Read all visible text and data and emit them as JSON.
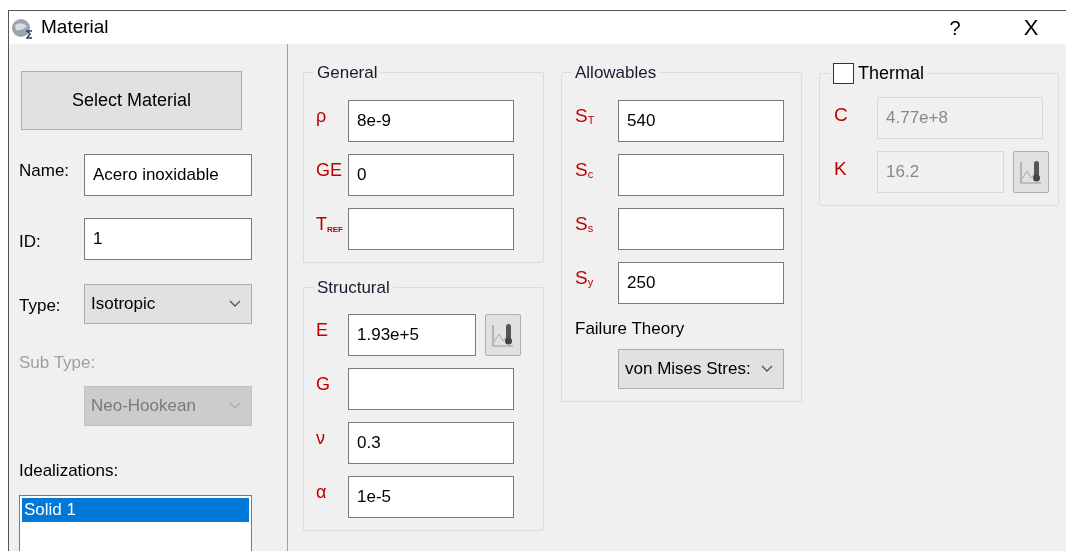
{
  "window": {
    "title": "Material",
    "help": "?",
    "close": "X"
  },
  "left": {
    "select_button": "Select Material",
    "name": {
      "label": "Name:",
      "value": "Acero inoxidable"
    },
    "id": {
      "label": "ID:",
      "value": "1"
    },
    "type": {
      "label": "Type:",
      "value": "Isotropic",
      "disabled": false
    },
    "sub_type": {
      "label": "Sub Type:",
      "value": "Neo-Hookean",
      "disabled": true
    },
    "idealizations": {
      "label": "Idealizations:",
      "items": [
        {
          "label": "Solid 1",
          "selected": true
        }
      ]
    }
  },
  "general": {
    "title": "General",
    "fields": [
      {
        "label": "ρ",
        "value": "8e-9",
        "kind": "plain",
        "disabled": false
      },
      {
        "label": "GE",
        "value": "0",
        "kind": "plain",
        "disabled": false
      },
      {
        "label": "T$_{REF}$",
        "kind": "plain",
        "disabled": false
      }
    ]
  },
  "structural": {
    "title": "Structural",
    "fields": [
      {
        "label": "E",
        "value": "1.93e+5",
        "kind": "chart",
        "disabled": false
      },
      {
        "label": "G",
        "kind": "plain",
        "disabled": false
      },
      {
        "label": "ν",
        "value": "0.3",
        "kind": "plain",
        "disabled": false
      },
      {
        "label": "α",
        "value": "1e-5",
        "kind": "plain",
        "disabled": false
      }
    ]
  },
  "allowables": {
    "title": "Allowables",
    "fields": [
      {
        "label": "S$_{T}$",
        "value": "540",
        "disabled": false
      },
      {
        "label": "S$_{c}$",
        "disabled": false
      },
      {
        "label": "S$_{s}$",
        "disabled": false
      },
      {
        "label": "S$_{y}$",
        "value": "250",
        "disabled": false
      }
    ],
    "failure_theory": {
      "label": "Failure Theory",
      "value": "von Mises Stres:"
    }
  },
  "thermal": {
    "title": "Thermal",
    "checked": false,
    "fields": [
      {
        "label": "C",
        "value": "4.77e+8",
        "kind": "plain",
        "disabled": true
      },
      {
        "label": "K",
        "value": "16.2",
        "kind": "chart",
        "disabled": true
      }
    ]
  }
}
